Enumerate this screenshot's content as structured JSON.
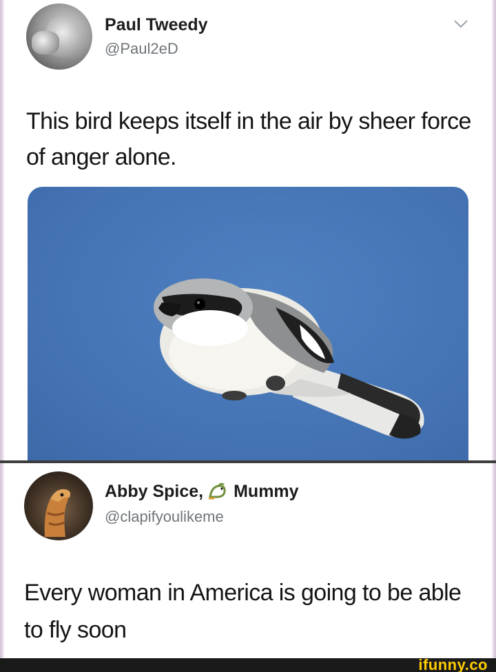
{
  "tweet1": {
    "author_name": "Paul Tweedy",
    "author_handle": "@Paul2eD",
    "text": "This bird keeps itself in the air by sheer force of anger alone.",
    "media_description_icon": "bird-photo"
  },
  "tweet2": {
    "author_name_part1": "Abby Spice,",
    "author_name_emoji": "dragon-emoji",
    "author_name_part2": "Mummy",
    "author_handle": "@clapifyoulikeme",
    "text": "Every woman in America is going to be able to fly soon"
  },
  "watermark": {
    "text": "ifunny.co"
  },
  "colors": {
    "sky": "#4675b6",
    "handle_gray": "#6f7478",
    "watermark_yellow": "#ffcc00"
  }
}
